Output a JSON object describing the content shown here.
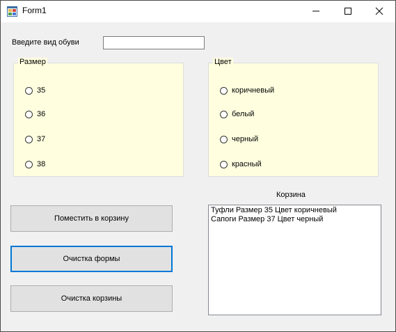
{
  "window": {
    "title": "Form1",
    "icons": {
      "app": "form-app-icon",
      "minimize": "minimize-icon",
      "maximize": "maximize-icon",
      "close": "close-icon"
    }
  },
  "form": {
    "shoe_type_label": "Введите вид обуви",
    "shoe_type_value": "",
    "size_group": {
      "title": "Размер",
      "options": [
        "35",
        "36",
        "37",
        "38"
      ]
    },
    "color_group": {
      "title": "Цвет",
      "options": [
        "коричневый",
        "белый",
        "черный",
        "красный"
      ]
    },
    "buttons": {
      "add_to_cart": "Поместить в корзину",
      "clear_form": "Очистка формы",
      "clear_cart": "Очистка корзины"
    },
    "cart": {
      "title": "Корзина",
      "items": [
        "Туфли Размер 35 Цвет коричневый",
        "Сапоги Размер 37 Цвет черный"
      ]
    }
  },
  "colors": {
    "group_bg": "#ffffe0",
    "focus_border": "#0078d7",
    "button_bg": "#e1e1e1",
    "window_bg": "#f0f0f0"
  }
}
